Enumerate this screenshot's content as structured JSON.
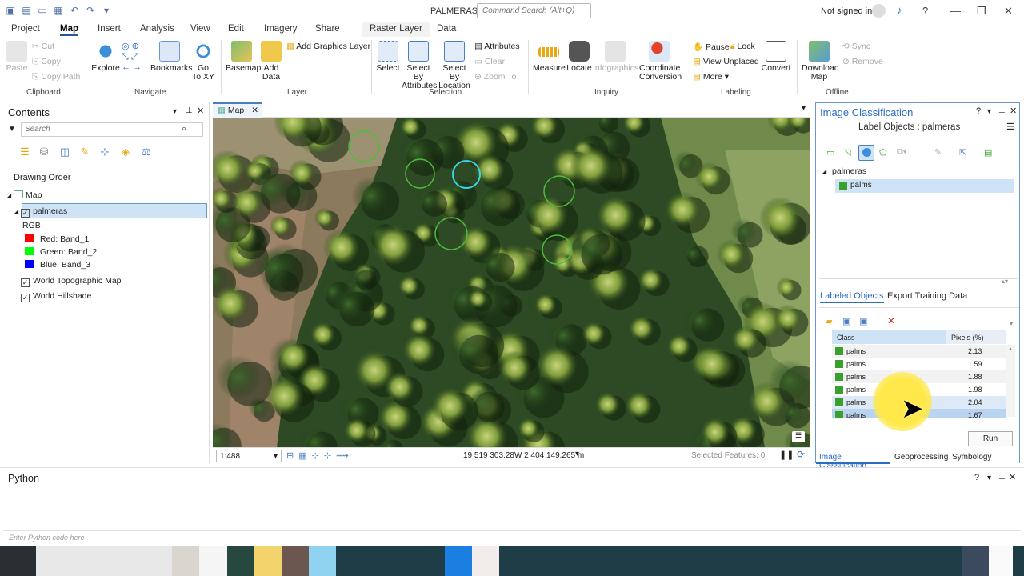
{
  "title_bar": {
    "app_title": "PALMERAS",
    "command_search_placeholder": "Command Search (Alt+Q)",
    "sign_in": "Not signed in",
    "help": "?"
  },
  "tabs": [
    "Project",
    "Map",
    "Insert",
    "Analysis",
    "View",
    "Edit",
    "Imagery",
    "Share",
    "Raster Layer",
    "Data"
  ],
  "ribbon": {
    "clipboard": {
      "paste": "Paste",
      "cut": "Cut",
      "copy": "Copy",
      "copy_path": "Copy Path",
      "group": "Clipboard"
    },
    "navigate": {
      "explore": "Explore",
      "bookmarks": "Bookmarks",
      "go_to": "Go",
      "go_to_2": "To XY",
      "group": "Navigate"
    },
    "layer": {
      "basemap": "Basemap",
      "add": "Add",
      "data": "Data",
      "add_graphics": "Add Graphics Layer",
      "group": "Layer"
    },
    "selection": {
      "select": "Select",
      "select_by": "Select By",
      "attributes": "Attributes",
      "select_by_2": "Select By",
      "location": "Location",
      "attributes_btn": "Attributes",
      "clear": "Clear",
      "zoom_to": "Zoom To",
      "group": "Selection"
    },
    "inquiry": {
      "measure": "Measure",
      "locate": "Locate",
      "infographics": "Infographics",
      "coordinate": "Coordinate",
      "conversion": "Conversion",
      "group": "Inquiry"
    },
    "labeling": {
      "pause": "Pause",
      "lock": "Lock",
      "view_unplaced": "View Unplaced",
      "more": "More",
      "convert": "Convert",
      "group": "Labeling"
    },
    "offline": {
      "download": "Download",
      "map": "Map",
      "sync": "Sync",
      "remove": "Remove",
      "group": "Offline"
    }
  },
  "contents": {
    "title": "Contents",
    "search_placeholder": "Search",
    "drawing_order": "Drawing Order",
    "map": "Map",
    "layer": "palmeras",
    "rgb": "RGB",
    "bands": [
      {
        "label": "Red:  Band_1",
        "color": "#ff0000"
      },
      {
        "label": "Green: Band_2",
        "color": "#00ff00"
      },
      {
        "label": "Blue:  Band_3",
        "color": "#0000ff"
      }
    ],
    "basemaps": [
      "World Topographic Map",
      "World Hillshade"
    ]
  },
  "map_view": {
    "tab": "Map",
    "scale": "1:488",
    "coords": "19 519 303.28W 2 404 149.265 m",
    "selected_features": "Selected Features: 0"
  },
  "image_classification": {
    "title": "Image Classification",
    "subtitle": "Label Objects : palmeras",
    "tree_root": "palmeras",
    "tree_class": "palms",
    "tab_labeled": "Labeled Objects",
    "tab_export": "Export Training Data",
    "col_class": "Class",
    "col_pixels": "Pixels (%)",
    "rows": [
      {
        "cls": "palms",
        "px": "2.13"
      },
      {
        "cls": "palms",
        "px": "1.59"
      },
      {
        "cls": "palms",
        "px": "1.88"
      },
      {
        "cls": "palms",
        "px": "1.98"
      },
      {
        "cls": "palms",
        "px": "2.04"
      },
      {
        "cls": "palms",
        "px": "1.67"
      }
    ],
    "run": "Run",
    "bottom_tabs": [
      "Image Classification",
      "Geoprocessing",
      "Symbology"
    ],
    "class_color": "#3aa02c"
  },
  "python": {
    "title": "Python",
    "placeholder": "Enter Python code here"
  }
}
